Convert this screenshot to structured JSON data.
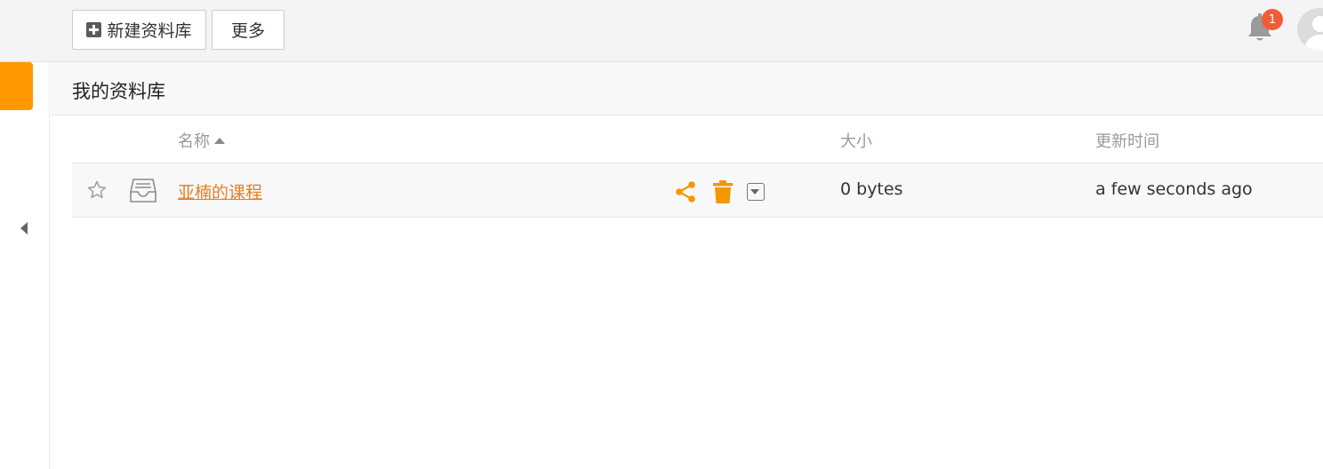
{
  "toolbar": {
    "new_library_label": "新建资料库",
    "more_label": "更多"
  },
  "notifications": {
    "count": "1"
  },
  "page": {
    "title": "我的资料库"
  },
  "table": {
    "columns": {
      "name": "名称",
      "size": "大小",
      "updated": "更新时间"
    },
    "rows": [
      {
        "name": "亚楠的课程",
        "size": "0 bytes",
        "updated": "a few seconds ago"
      }
    ]
  },
  "colors": {
    "accent": "#ff9800",
    "link": "#e67e22",
    "badge": "#f25c35"
  },
  "icons": {
    "new": "plus-square-icon",
    "notification": "bell-icon",
    "user": "avatar-icon",
    "star": "star-outline-icon",
    "library": "inbox-icon",
    "share": "share-icon",
    "delete": "trash-icon",
    "more": "caret-down-square-icon",
    "collapse": "caret-left-icon"
  }
}
